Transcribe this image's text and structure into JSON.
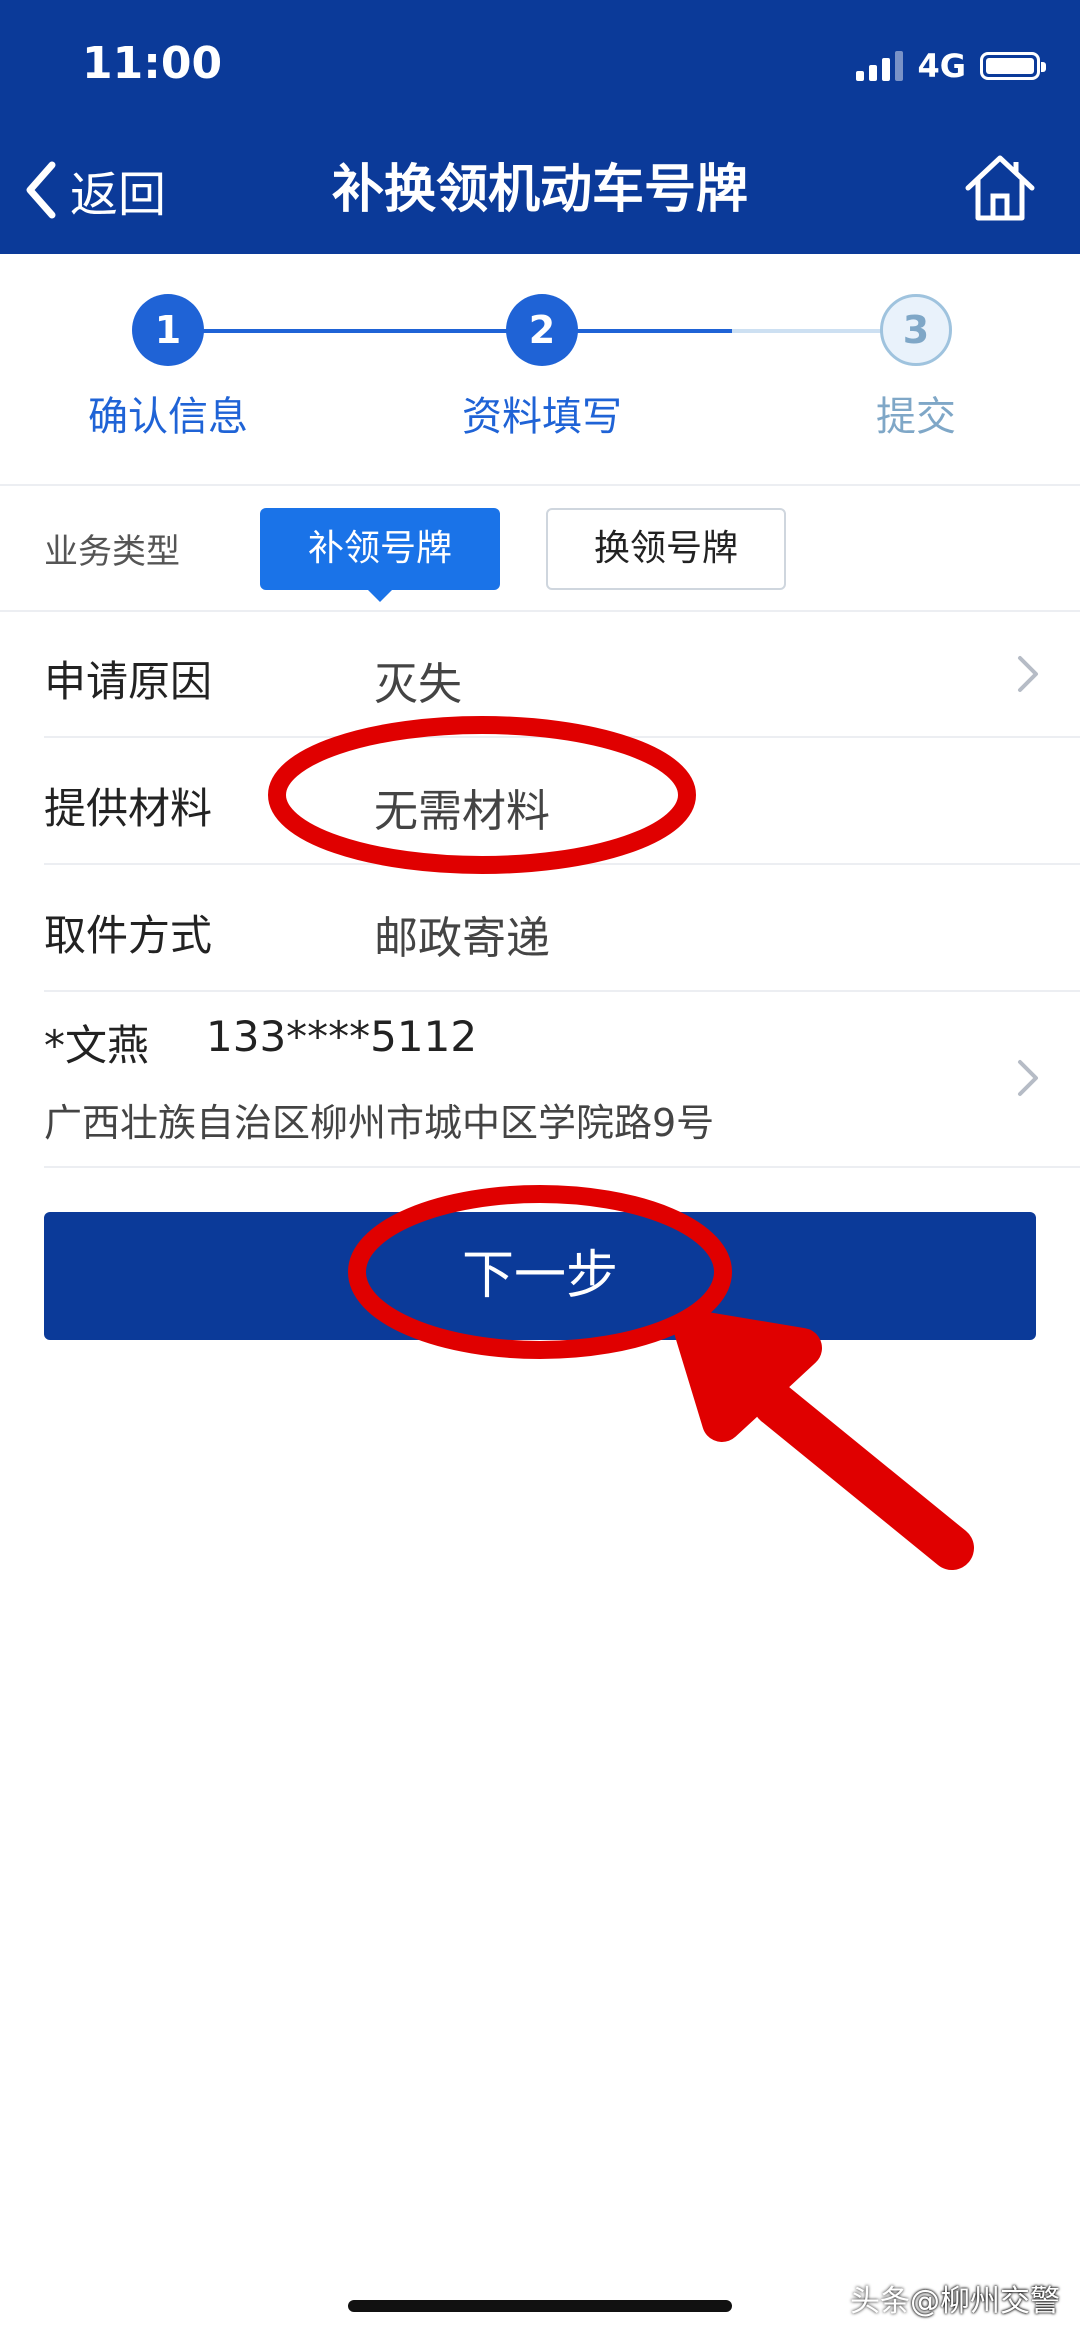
{
  "status_bar": {
    "time": "11:00",
    "network": "4G"
  },
  "header": {
    "back_label": "返回",
    "title": "补换领机动车号牌"
  },
  "steps": [
    {
      "number": "1",
      "label": "确认信息",
      "state": "done"
    },
    {
      "number": "2",
      "label": "资料填写",
      "state": "active"
    },
    {
      "number": "3",
      "label": "提交",
      "state": "pending"
    }
  ],
  "business": {
    "label": "业务类型",
    "options": [
      "补领号牌",
      "换领号牌"
    ],
    "selected": "补领号牌"
  },
  "form": {
    "reason": {
      "label": "申请原因",
      "value": "灭失"
    },
    "materials": {
      "label": "提供材料",
      "value": "无需材料"
    },
    "pickup": {
      "label": "取件方式",
      "value": "邮政寄递"
    }
  },
  "address": {
    "name": "*文燕",
    "phone": "133****5112",
    "line": "广西壮族自治区柳州市城中区学院路9号"
  },
  "next_button": {
    "label": "下一步"
  },
  "watermark": {
    "prefix": "头条",
    "text": "@柳州交警"
  },
  "colors": {
    "header": "#0b3a99",
    "accent": "#1a73e8",
    "annotation": "#e00000"
  }
}
